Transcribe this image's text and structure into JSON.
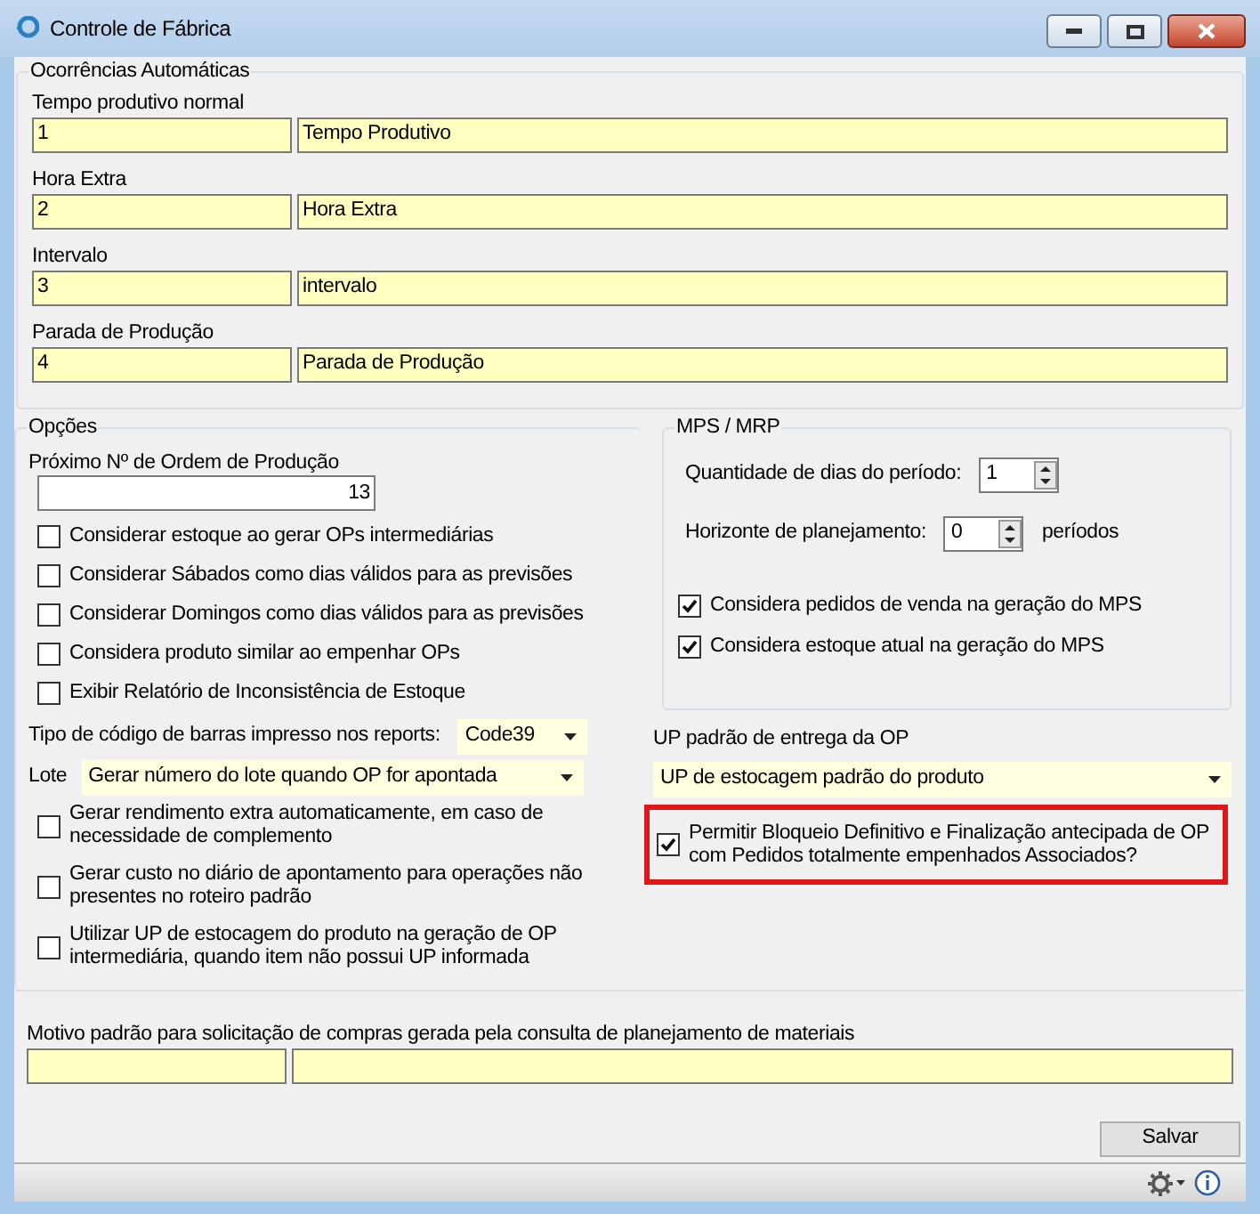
{
  "window": {
    "title": "Controle de Fábrica"
  },
  "occurrences": {
    "title": "Ocorrências Automáticas",
    "rows": [
      {
        "label": "Tempo produtivo normal",
        "code": "1",
        "name": "Tempo Produtivo"
      },
      {
        "label": "Hora Extra",
        "code": "2",
        "name": "Hora Extra"
      },
      {
        "label": "Intervalo",
        "code": "3",
        "name": "intervalo"
      },
      {
        "label": "Parada de Produção",
        "code": "4",
        "name": "Parada de Produção"
      }
    ]
  },
  "options": {
    "title": "Opções",
    "next_order": {
      "label": "Próximo Nº de Ordem de Produção",
      "value": "13"
    },
    "checkboxes": [
      {
        "label": "Considerar estoque ao gerar OPs intermediárias",
        "checked": false
      },
      {
        "label": "Considerar Sábados como dias válidos para as previsões",
        "checked": false
      },
      {
        "label": "Considerar Domingos como dias válidos para as previsões",
        "checked": false
      },
      {
        "label": "Considera produto similar ao empenhar OPs",
        "checked": false
      },
      {
        "label": "Exibir Relatório de Inconsistência de Estoque",
        "checked": false
      }
    ],
    "barcode": {
      "label": "Tipo de código de barras impresso nos reports:",
      "value": "Code39"
    },
    "lot": {
      "label": "Lote",
      "value": "Gerar número do lote quando OP for apontada"
    },
    "checkboxes_2": [
      {
        "label": "Gerar rendimento extra automaticamente, em caso de necessidade de complemento",
        "checked": false
      },
      {
        "label": "Gerar custo no diário de apontamento para operações não presentes no roteiro padrão",
        "checked": false
      },
      {
        "label": "Utilizar UP de estocagem do produto na geração de OP intermediária, quando item não possui UP informada",
        "checked": false
      }
    ]
  },
  "mps": {
    "title": "MPS / MRP",
    "period_days": {
      "label": "Quantidade de dias do período:",
      "value": "1"
    },
    "horizon": {
      "label": "Horizonte de planejamento:",
      "value": "0",
      "unit": "períodos"
    },
    "checkboxes": [
      {
        "label": "Considera pedidos de venda na geração do MPS",
        "checked": true
      },
      {
        "label": "Considera estoque atual na geração do MPS",
        "checked": true
      }
    ]
  },
  "up_delivery": {
    "label": "UP padrão de entrega da OP",
    "value": "UP de estocagem padrão do produto"
  },
  "early_block": {
    "label": "Permitir Bloqueio Definitivo e Finalização antecipada de OP com Pedidos totalmente empenhados Associados?",
    "checked": true,
    "highlighted": true
  },
  "purchase_reason": {
    "label": "Motivo padrão para solicitação de compras gerada pela consulta de planejamento de materiais"
  },
  "save_button": "Salvar"
}
